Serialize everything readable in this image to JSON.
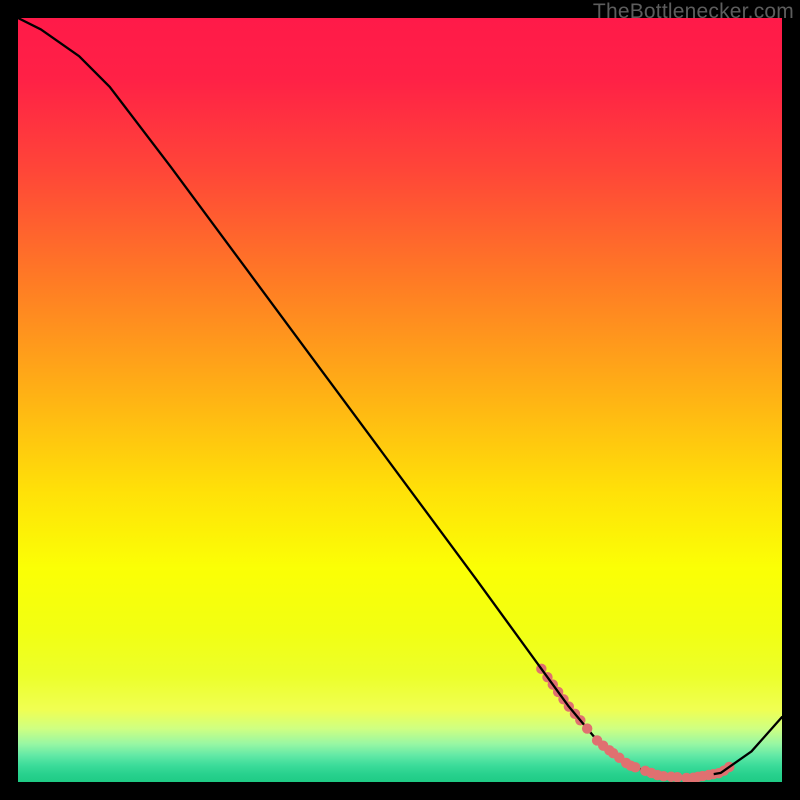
{
  "watermark": "TheBottlenecker.com",
  "chart_data": {
    "type": "line",
    "title": "",
    "xlabel": "",
    "ylabel": "",
    "xlim": [
      0,
      100
    ],
    "ylim": [
      0,
      100
    ],
    "x": [
      0,
      3,
      8,
      12,
      20,
      30,
      40,
      50,
      60,
      68,
      72,
      76,
      80,
      84,
      88,
      92,
      96,
      100
    ],
    "values": [
      100,
      98.5,
      95,
      91,
      80.5,
      67,
      53.5,
      40,
      26.5,
      15.5,
      10,
      5.2,
      2.2,
      0.8,
      0.5,
      1.2,
      4,
      8.5
    ],
    "marker_gaps_x": [
      68.5,
      69.3,
      70.0,
      70.7,
      71.4,
      72.1,
      72.9,
      73.6,
      91.0,
      91.7,
      92.4,
      93.1
    ],
    "marker_points_x": [
      74.5,
      75.8,
      76.6,
      77.4,
      77.9,
      78.7,
      79.6,
      80.2,
      80.8,
      82.1,
      82.9,
      83.7,
      84.5,
      85.5,
      86.3,
      87.5,
      88.4,
      89.0,
      89.6,
      90.4
    ],
    "gradient_stops": [
      {
        "offset": 0.0,
        "color": "#ff1a49"
      },
      {
        "offset": 0.08,
        "color": "#ff2146"
      },
      {
        "offset": 0.2,
        "color": "#ff4638"
      },
      {
        "offset": 0.35,
        "color": "#ff7d24"
      },
      {
        "offset": 0.5,
        "color": "#ffb414"
      },
      {
        "offset": 0.62,
        "color": "#ffe108"
      },
      {
        "offset": 0.72,
        "color": "#fbff05"
      },
      {
        "offset": 0.8,
        "color": "#f2ff12"
      },
      {
        "offset": 0.86,
        "color": "#ecff2a"
      },
      {
        "offset": 0.905,
        "color": "#f0ff52"
      },
      {
        "offset": 0.93,
        "color": "#cfff82"
      },
      {
        "offset": 0.95,
        "color": "#98f7a3"
      },
      {
        "offset": 0.965,
        "color": "#63e9a6"
      },
      {
        "offset": 0.978,
        "color": "#3cdc9a"
      },
      {
        "offset": 0.99,
        "color": "#27d18d"
      },
      {
        "offset": 1.0,
        "color": "#1fcb85"
      }
    ],
    "marker_color": "#e07070",
    "line_color": "#000000"
  }
}
